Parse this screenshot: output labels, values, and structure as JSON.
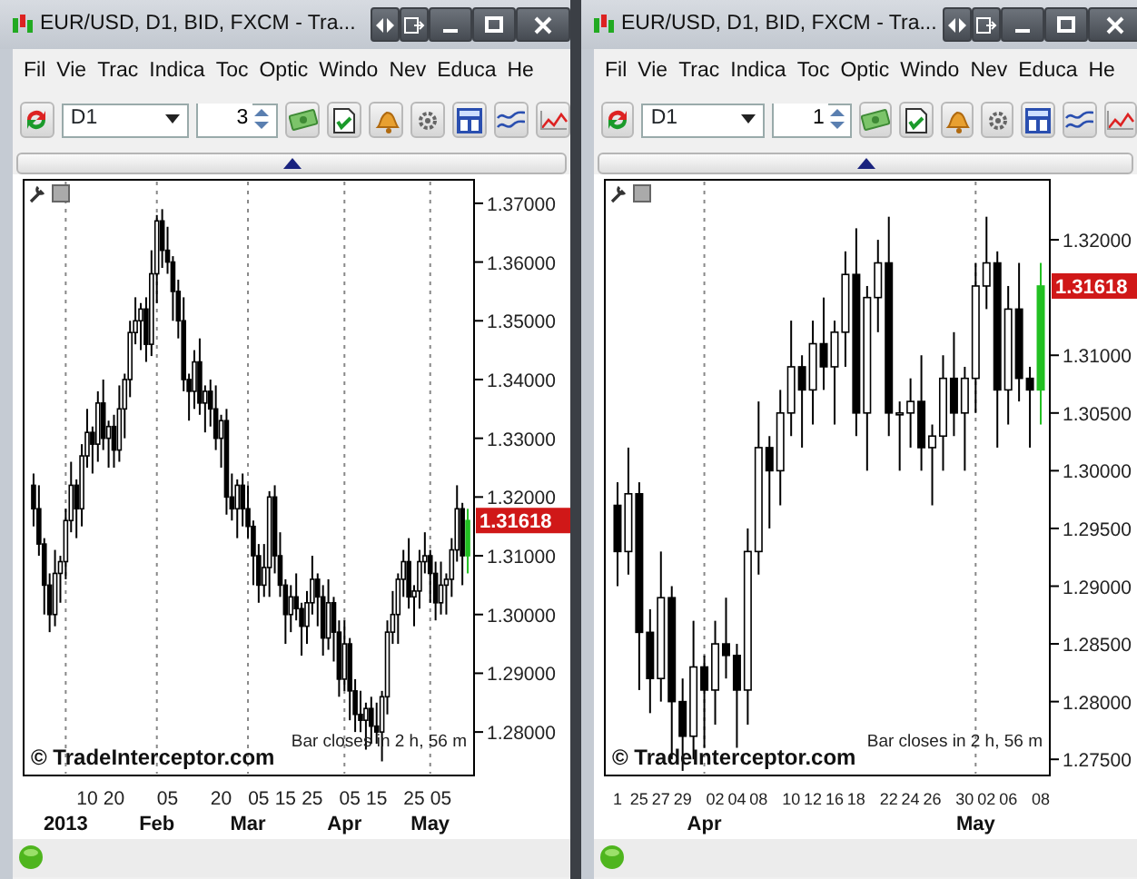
{
  "windows": [
    {
      "title": "EUR/USD, D1, BID, FXCM - Tra...",
      "menu": [
        "Fil",
        "Vie",
        "Trac",
        "Indica",
        "Toc",
        "Optic",
        "Windo",
        "Nev",
        "Educa",
        "He"
      ],
      "timeframe": "D1",
      "bar_count": "3",
      "chart": {
        "current_price": "1.31618",
        "branding": "© TradeInterceptor.com",
        "bar_timer": "Bar closes in 2 h, 56 m",
        "month_labels": [
          "2013",
          "Feb",
          "Mar",
          "Apr",
          "May"
        ],
        "chart_data": {
          "type": "candlestick",
          "ylim": [
            1.2726,
            1.374
          ],
          "yticks": [
            {
              "value": 1.37,
              "label": "1.37000"
            },
            {
              "value": 1.36,
              "label": "1.36000"
            },
            {
              "value": 1.35,
              "label": "1.35000"
            },
            {
              "value": 1.34,
              "label": "1.34000"
            },
            {
              "value": 1.33,
              "label": "1.33000"
            },
            {
              "value": 1.32,
              "label": "1.32000"
            },
            {
              "value": 1.31,
              "label": "1.31000"
            },
            {
              "value": 1.3,
              "label": "1.30000"
            },
            {
              "value": 1.29,
              "label": "1.29000"
            },
            {
              "value": 1.28,
              "label": "1.28000"
            }
          ],
          "categories": [
            null,
            null,
            null,
            null,
            null,
            null,
            null,
            null,
            null,
            null,
            "10",
            null,
            null,
            null,
            null,
            "20",
            null,
            null,
            null,
            null,
            null,
            null,
            null,
            null,
            null,
            "05",
            null,
            null,
            null,
            null,
            null,
            null,
            null,
            null,
            null,
            "20",
            null,
            null,
            null,
            null,
            null,
            null,
            "05",
            null,
            null,
            null,
            null,
            "15",
            null,
            null,
            null,
            null,
            "25",
            null,
            null,
            null,
            null,
            null,
            null,
            "05",
            null,
            null,
            null,
            null,
            "15",
            null,
            null,
            null,
            null,
            null,
            null,
            "25",
            null,
            null,
            null,
            null,
            "05",
            null,
            null,
            null,
            null,
            null
          ],
          "series": [
            {
              "ohlc": [
                [
                  1.322,
                  1.324,
                  1.315,
                  1.318
                ],
                [
                  1.318,
                  1.322,
                  1.31,
                  1.312
                ],
                [
                  1.312,
                  1.313,
                  1.3,
                  1.305
                ],
                [
                  1.305,
                  1.307,
                  1.297,
                  1.3
                ],
                [
                  1.3,
                  1.311,
                  1.298,
                  1.307
                ],
                [
                  1.307,
                  1.31,
                  1.302,
                  1.309
                ],
                [
                  1.309,
                  1.318,
                  1.306,
                  1.316
                ],
                [
                  1.316,
                  1.326,
                  1.314,
                  1.322
                ],
                [
                  1.322,
                  1.323,
                  1.313,
                  1.318
                ],
                [
                  1.318,
                  1.329,
                  1.315,
                  1.327
                ],
                [
                  1.327,
                  1.335,
                  1.325,
                  1.331
                ],
                [
                  1.331,
                  1.332,
                  1.324,
                  1.329
                ],
                [
                  1.329,
                  1.338,
                  1.326,
                  1.336
                ],
                [
                  1.336,
                  1.34,
                  1.328,
                  1.33
                ],
                [
                  1.33,
                  1.333,
                  1.325,
                  1.332
                ],
                [
                  1.332,
                  1.334,
                  1.325,
                  1.328
                ],
                [
                  1.328,
                  1.339,
                  1.326,
                  1.335
                ],
                [
                  1.335,
                  1.341,
                  1.33,
                  1.34
                ],
                [
                  1.34,
                  1.35,
                  1.337,
                  1.348
                ],
                [
                  1.348,
                  1.354,
                  1.346,
                  1.35
                ],
                [
                  1.35,
                  1.353,
                  1.345,
                  1.352
                ],
                [
                  1.352,
                  1.354,
                  1.343,
                  1.346
                ],
                [
                  1.346,
                  1.362,
                  1.344,
                  1.358
                ],
                [
                  1.358,
                  1.368,
                  1.353,
                  1.367
                ],
                [
                  1.367,
                  1.369,
                  1.359,
                  1.362
                ],
                [
                  1.362,
                  1.366,
                  1.358,
                  1.36
                ],
                [
                  1.36,
                  1.361,
                  1.35,
                  1.355
                ],
                [
                  1.355,
                  1.357,
                  1.347,
                  1.35
                ],
                [
                  1.35,
                  1.354,
                  1.338,
                  1.34
                ],
                [
                  1.34,
                  1.341,
                  1.333,
                  1.338
                ],
                [
                  1.338,
                  1.345,
                  1.335,
                  1.343
                ],
                [
                  1.343,
                  1.347,
                  1.334,
                  1.336
                ],
                [
                  1.336,
                  1.339,
                  1.331,
                  1.338
                ],
                [
                  1.338,
                  1.34,
                  1.332,
                  1.335
                ],
                [
                  1.335,
                  1.339,
                  1.328,
                  1.33
                ],
                [
                  1.33,
                  1.334,
                  1.325,
                  1.333
                ],
                [
                  1.333,
                  1.335,
                  1.317,
                  1.32
                ],
                [
                  1.32,
                  1.324,
                  1.316,
                  1.318
                ],
                [
                  1.318,
                  1.323,
                  1.313,
                  1.322
                ],
                [
                  1.322,
                  1.324,
                  1.315,
                  1.318
                ],
                [
                  1.318,
                  1.322,
                  1.313,
                  1.315
                ],
                [
                  1.315,
                  1.316,
                  1.305,
                  1.31
                ],
                [
                  1.31,
                  1.312,
                  1.302,
                  1.305
                ],
                [
                  1.305,
                  1.312,
                  1.303,
                  1.308
                ],
                [
                  1.308,
                  1.321,
                  1.303,
                  1.32
                ],
                [
                  1.32,
                  1.322,
                  1.307,
                  1.31
                ],
                [
                  1.31,
                  1.314,
                  1.303,
                  1.305
                ],
                [
                  1.305,
                  1.306,
                  1.295,
                  1.3
                ],
                [
                  1.3,
                  1.305,
                  1.297,
                  1.303
                ],
                [
                  1.303,
                  1.307,
                  1.299,
                  1.301
                ],
                [
                  1.301,
                  1.302,
                  1.293,
                  1.298
                ],
                [
                  1.298,
                  1.304,
                  1.295,
                  1.302
                ],
                [
                  1.302,
                  1.31,
                  1.3,
                  1.306
                ],
                [
                  1.306,
                  1.307,
                  1.298,
                  1.303
                ],
                [
                  1.303,
                  1.305,
                  1.293,
                  1.296
                ],
                [
                  1.296,
                  1.306,
                  1.294,
                  1.302
                ],
                [
                  1.302,
                  1.303,
                  1.292,
                  1.297
                ],
                [
                  1.297,
                  1.299,
                  1.286,
                  1.289
                ],
                [
                  1.289,
                  1.299,
                  1.287,
                  1.295
                ],
                [
                  1.295,
                  1.296,
                  1.282,
                  1.287
                ],
                [
                  1.287,
                  1.289,
                  1.28,
                  1.283
                ],
                [
                  1.283,
                  1.287,
                  1.28,
                  1.282
                ],
                [
                  1.282,
                  1.285,
                  1.277,
                  1.284
                ],
                [
                  1.284,
                  1.286,
                  1.278,
                  1.281
                ],
                [
                  1.281,
                  1.285,
                  1.278,
                  1.28
                ],
                [
                  1.28,
                  1.287,
                  1.275,
                  1.286
                ],
                [
                  1.286,
                  1.299,
                  1.283,
                  1.297
                ],
                [
                  1.297,
                  1.304,
                  1.295,
                  1.3
                ],
                [
                  1.3,
                  1.307,
                  1.295,
                  1.306
                ],
                [
                  1.306,
                  1.311,
                  1.303,
                  1.309
                ],
                [
                  1.309,
                  1.313,
                  1.301,
                  1.303
                ],
                [
                  1.303,
                  1.305,
                  1.298,
                  1.304
                ],
                [
                  1.304,
                  1.311,
                  1.301,
                  1.309
                ],
                [
                  1.309,
                  1.314,
                  1.307,
                  1.31
                ],
                [
                  1.31,
                  1.311,
                  1.302,
                  1.307
                ],
                [
                  1.307,
                  1.309,
                  1.299,
                  1.302
                ],
                [
                  1.302,
                  1.309,
                  1.3,
                  1.305
                ],
                [
                  1.305,
                  1.307,
                  1.3,
                  1.306
                ],
                [
                  1.306,
                  1.313,
                  1.303,
                  1.311
                ],
                [
                  1.311,
                  1.322,
                  1.309,
                  1.318
                ],
                [
                  1.318,
                  1.319,
                  1.305,
                  1.31
                ],
                null
              ]
            },
            {
              "color": "#22c022",
              "ohlc": [
                null,
                null,
                null,
                null,
                null,
                null,
                null,
                null,
                null,
                null,
                null,
                null,
                null,
                null,
                null,
                null,
                null,
                null,
                null,
                null,
                null,
                null,
                null,
                null,
                null,
                null,
                null,
                null,
                null,
                null,
                null,
                null,
                null,
                null,
                null,
                null,
                null,
                null,
                null,
                null,
                null,
                null,
                null,
                null,
                null,
                null,
                null,
                null,
                null,
                null,
                null,
                null,
                null,
                null,
                null,
                null,
                null,
                null,
                null,
                null,
                null,
                null,
                null,
                null,
                null,
                null,
                null,
                null,
                null,
                null,
                null,
                null,
                null,
                null,
                null,
                null,
                null,
                null,
                null,
                null,
                null,
                [
                  1.31,
                  1.318,
                  1.307,
                  1.316
                ]
              ]
            }
          ]
        }
      }
    },
    {
      "title": "EUR/USD, D1, BID, FXCM - Tra...",
      "menu": [
        "Fil",
        "Vie",
        "Trac",
        "Indica",
        "Toc",
        "Optic",
        "Windo",
        "Nev",
        "Educa",
        "He"
      ],
      "timeframe": "D1",
      "bar_count": "1",
      "chart": {
        "current_price": "1.31618",
        "branding": "© TradeInterceptor.com",
        "bar_timer": "Bar closes in 2 h, 56 m",
        "month_labels": [
          "Apr",
          "May"
        ],
        "chart_data": {
          "type": "candlestick",
          "ylim": [
            1.2736,
            1.3252
          ],
          "yticks": [
            {
              "value": 1.32,
              "label": "1.32000"
            },
            {
              "value": 1.31,
              "label": "1.31000"
            },
            {
              "value": 1.305,
              "label": "1.30500"
            },
            {
              "value": 1.3,
              "label": "1.30000"
            },
            {
              "value": 1.295,
              "label": "1.29500"
            },
            {
              "value": 1.29,
              "label": "1.29000"
            },
            {
              "value": 1.285,
              "label": "1.28500"
            },
            {
              "value": 1.28,
              "label": "1.28000"
            },
            {
              "value": 1.275,
              "label": "1.27500"
            }
          ],
          "categories": [
            "1",
            null,
            "25",
            null,
            "27",
            null,
            "29",
            null,
            null,
            "02",
            null,
            "04",
            null,
            "08",
            null,
            null,
            "10",
            null,
            "12",
            null,
            "16",
            null,
            "18",
            null,
            null,
            "22",
            null,
            "24",
            null,
            "26",
            null,
            null,
            "30",
            null,
            "02",
            null,
            "06",
            null,
            null,
            "08"
          ],
          "series": [
            {
              "ohlc": [
                [
                  1.297,
                  1.299,
                  1.29,
                  1.293
                ],
                [
                  1.293,
                  1.302,
                  1.291,
                  1.298
                ],
                [
                  1.298,
                  1.299,
                  1.281,
                  1.286
                ],
                [
                  1.286,
                  1.288,
                  1.279,
                  1.282
                ],
                [
                  1.282,
                  1.293,
                  1.28,
                  1.289
                ],
                [
                  1.289,
                  1.29,
                  1.275,
                  1.28
                ],
                [
                  1.28,
                  1.282,
                  1.274,
                  1.277
                ],
                [
                  1.277,
                  1.287,
                  1.275,
                  1.283
                ],
                [
                  1.283,
                  1.284,
                  1.276,
                  1.281
                ],
                [
                  1.281,
                  1.287,
                  1.278,
                  1.285
                ],
                [
                  1.285,
                  1.289,
                  1.282,
                  1.284
                ],
                [
                  1.284,
                  1.285,
                  1.276,
                  1.281
                ],
                [
                  1.281,
                  1.295,
                  1.278,
                  1.293
                ],
                [
                  1.293,
                  1.306,
                  1.291,
                  1.302
                ],
                [
                  1.302,
                  1.303,
                  1.295,
                  1.3
                ],
                [
                  1.3,
                  1.307,
                  1.297,
                  1.305
                ],
                [
                  1.305,
                  1.313,
                  1.303,
                  1.309
                ],
                [
                  1.309,
                  1.31,
                  1.302,
                  1.307
                ],
                [
                  1.307,
                  1.313,
                  1.304,
                  1.311
                ],
                [
                  1.311,
                  1.315,
                  1.307,
                  1.309
                ],
                [
                  1.309,
                  1.313,
                  1.304,
                  1.312
                ],
                [
                  1.312,
                  1.319,
                  1.309,
                  1.317
                ],
                [
                  1.317,
                  1.321,
                  1.303,
                  1.305
                ],
                [
                  1.305,
                  1.316,
                  1.3,
                  1.315
                ],
                [
                  1.315,
                  1.32,
                  1.312,
                  1.318
                ],
                [
                  1.318,
                  1.322,
                  1.303,
                  1.305
                ],
                [
                  1.305,
                  1.306,
                  1.3,
                  1.305
                ],
                [
                  1.305,
                  1.308,
                  1.302,
                  1.306
                ],
                [
                  1.306,
                  1.31,
                  1.3,
                  1.302
                ],
                [
                  1.302,
                  1.304,
                  1.297,
                  1.303
                ],
                [
                  1.303,
                  1.31,
                  1.3,
                  1.308
                ],
                [
                  1.308,
                  1.312,
                  1.303,
                  1.305
                ],
                [
                  1.305,
                  1.309,
                  1.3,
                  1.308
                ],
                [
                  1.308,
                  1.318,
                  1.305,
                  1.316
                ],
                [
                  1.316,
                  1.322,
                  1.314,
                  1.318
                ],
                [
                  1.318,
                  1.319,
                  1.302,
                  1.307
                ],
                [
                  1.307,
                  1.316,
                  1.304,
                  1.314
                ],
                [
                  1.314,
                  1.318,
                  1.306,
                  1.308
                ],
                [
                  1.308,
                  1.309,
                  1.302,
                  1.307
                ],
                null
              ]
            },
            {
              "color": "#22c022",
              "ohlc": [
                null,
                null,
                null,
                null,
                null,
                null,
                null,
                null,
                null,
                null,
                null,
                null,
                null,
                null,
                null,
                null,
                null,
                null,
                null,
                null,
                null,
                null,
                null,
                null,
                null,
                null,
                null,
                null,
                null,
                null,
                null,
                null,
                null,
                null,
                null,
                null,
                null,
                null,
                null,
                [
                  1.307,
                  1.318,
                  1.304,
                  1.316
                ]
              ]
            }
          ]
        }
      }
    }
  ]
}
